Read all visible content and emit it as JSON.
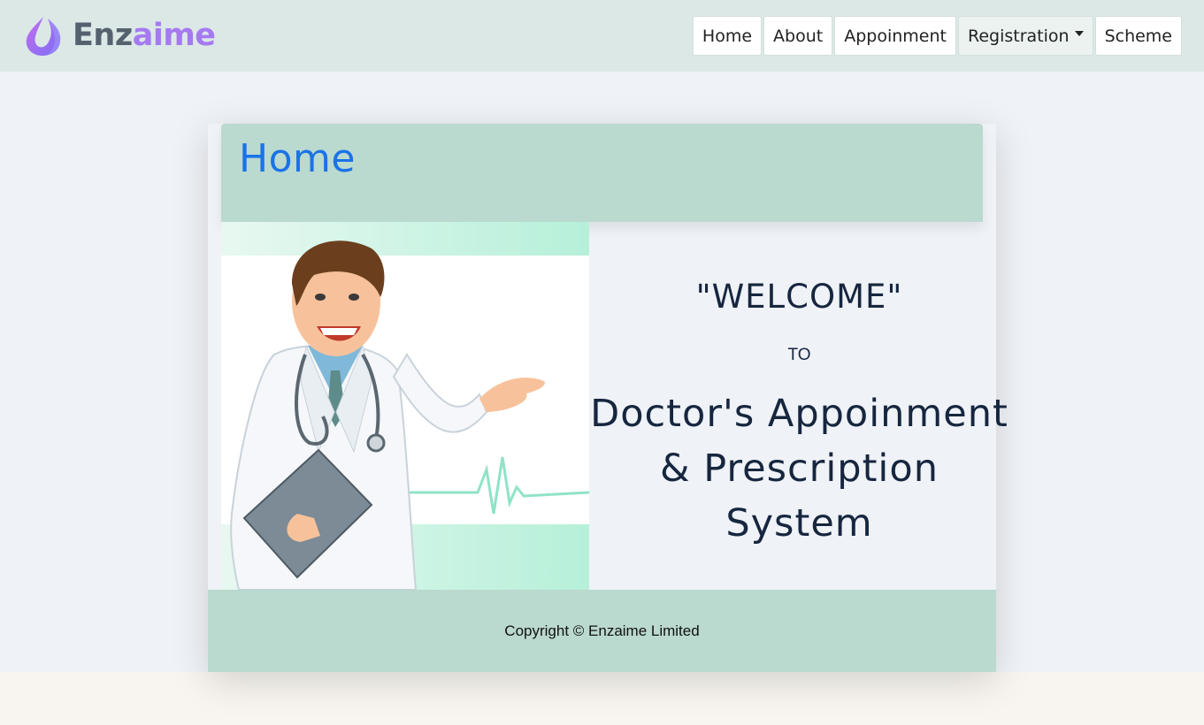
{
  "brand": {
    "name_part1": "Enz",
    "name_part2": "aime",
    "logo_icon": "drop-logo-icon"
  },
  "nav": {
    "items": [
      {
        "label": "Home"
      },
      {
        "label": "About"
      },
      {
        "label": "Appoinment"
      },
      {
        "label": "Registration",
        "has_dropdown": true
      },
      {
        "label": "Scheme"
      }
    ]
  },
  "card": {
    "title": "Home",
    "welcome_quote": "\"WELCOME\"",
    "welcome_to": "TO",
    "system_title": "Doctor's Appoinment & Prescription System",
    "illustration_icon": "doctor-illustration"
  },
  "footer": {
    "copyright": "Copyright © Enzaime Limited"
  },
  "colors": {
    "navbar_bg": "#dce8e6",
    "header_bg": "#bad9cf",
    "title_blue": "#1a73e8",
    "brand_purple": "#a57af0",
    "text_dark": "#16263f"
  }
}
